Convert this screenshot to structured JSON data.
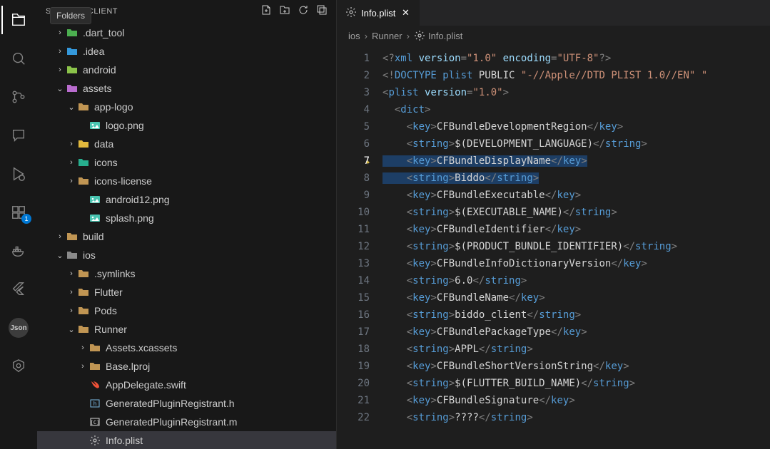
{
  "tooltip": "Folders",
  "sidebarHeader": {
    "title": "S: BIDDO_CLIENT"
  },
  "badge": "1",
  "jsonLabel": "Json",
  "tree": [
    {
      "indent": 1,
      "twist": "›",
      "icon": "folder-green",
      "label": ".dart_tool"
    },
    {
      "indent": 1,
      "twist": "›",
      "icon": "folder-blue",
      "label": ".idea"
    },
    {
      "indent": 1,
      "twist": "›",
      "icon": "folder-lime",
      "label": "android"
    },
    {
      "indent": 1,
      "twist": "⌄",
      "icon": "folder-pink",
      "label": "assets"
    },
    {
      "indent": 2,
      "twist": "⌄",
      "icon": "folder",
      "label": "app-logo"
    },
    {
      "indent": 3,
      "twist": "",
      "icon": "img",
      "label": "logo.png"
    },
    {
      "indent": 2,
      "twist": "›",
      "icon": "folder-yellow",
      "label": "data"
    },
    {
      "indent": 2,
      "twist": "›",
      "icon": "folder-teal",
      "label": "icons"
    },
    {
      "indent": 2,
      "twist": "›",
      "icon": "folder",
      "label": "icons-license"
    },
    {
      "indent": 3,
      "twist": "",
      "icon": "img",
      "label": "android12.png"
    },
    {
      "indent": 3,
      "twist": "",
      "icon": "img",
      "label": "splash.png"
    },
    {
      "indent": 1,
      "twist": "›",
      "icon": "folder",
      "label": "build"
    },
    {
      "indent": 1,
      "twist": "⌄",
      "icon": "folder-gray",
      "label": "ios"
    },
    {
      "indent": 2,
      "twist": "›",
      "icon": "folder",
      "label": ".symlinks"
    },
    {
      "indent": 2,
      "twist": "›",
      "icon": "folder",
      "label": "Flutter"
    },
    {
      "indent": 2,
      "twist": "›",
      "icon": "folder",
      "label": "Pods"
    },
    {
      "indent": 2,
      "twist": "⌄",
      "icon": "folder",
      "label": "Runner"
    },
    {
      "indent": 3,
      "twist": "›",
      "icon": "folder",
      "label": "Assets.xcassets"
    },
    {
      "indent": 3,
      "twist": "›",
      "icon": "folder",
      "label": "Base.lproj"
    },
    {
      "indent": 3,
      "twist": "",
      "icon": "swift",
      "label": "AppDelegate.swift"
    },
    {
      "indent": 3,
      "twist": "",
      "icon": "h",
      "label": "GeneratedPluginRegistrant.h"
    },
    {
      "indent": 3,
      "twist": "",
      "icon": "c",
      "label": "GeneratedPluginRegistrant.m"
    },
    {
      "indent": 3,
      "twist": "",
      "icon": "gear",
      "label": "Info.plist",
      "selected": true
    }
  ],
  "tab": {
    "label": "Info.plist"
  },
  "breadcrumbs": [
    "ios",
    "Runner",
    "Info.plist"
  ],
  "code": [
    {
      "n": 1,
      "tokens": [
        {
          "c": "t-punc",
          "t": "<?"
        },
        {
          "c": "t-tag",
          "t": "xml "
        },
        {
          "c": "t-attr",
          "t": "version"
        },
        {
          "c": "t-punc",
          "t": "="
        },
        {
          "c": "t-str",
          "t": "\"1.0\""
        },
        {
          "c": "t-attr",
          "t": " encoding"
        },
        {
          "c": "t-punc",
          "t": "="
        },
        {
          "c": "t-str",
          "t": "\"UTF-8\""
        },
        {
          "c": "t-punc",
          "t": "?>"
        }
      ]
    },
    {
      "n": 2,
      "tokens": [
        {
          "c": "t-punc",
          "t": "<!"
        },
        {
          "c": "t-tag",
          "t": "DOCTYPE plist "
        },
        {
          "c": "t-text",
          "t": "PUBLIC "
        },
        {
          "c": "t-str",
          "t": "\"-//Apple//DTD PLIST 1.0//EN\" \""
        }
      ]
    },
    {
      "n": 3,
      "tokens": [
        {
          "c": "t-punc",
          "t": "<"
        },
        {
          "c": "t-tag",
          "t": "plist "
        },
        {
          "c": "t-attr",
          "t": "version"
        },
        {
          "c": "t-punc",
          "t": "="
        },
        {
          "c": "t-str",
          "t": "\"1.0\""
        },
        {
          "c": "t-punc",
          "t": ">"
        }
      ]
    },
    {
      "n": 4,
      "indent": 1,
      "tokens": [
        {
          "c": "t-punc",
          "t": "<"
        },
        {
          "c": "t-tag",
          "t": "dict"
        },
        {
          "c": "t-punc",
          "t": ">"
        }
      ]
    },
    {
      "n": 5,
      "indent": 2,
      "tokens": [
        {
          "c": "t-punc",
          "t": "<"
        },
        {
          "c": "t-tag",
          "t": "key"
        },
        {
          "c": "t-punc",
          "t": ">"
        },
        {
          "c": "t-text",
          "t": "CFBundleDevelopmentRegion"
        },
        {
          "c": "t-punc",
          "t": "</"
        },
        {
          "c": "t-tag",
          "t": "key"
        },
        {
          "c": "t-punc",
          "t": ">"
        }
      ]
    },
    {
      "n": 6,
      "indent": 2,
      "tokens": [
        {
          "c": "t-punc",
          "t": "<"
        },
        {
          "c": "t-tag",
          "t": "string"
        },
        {
          "c": "t-punc",
          "t": ">"
        },
        {
          "c": "t-text",
          "t": "$(DEVELOPMENT_LANGUAGE)"
        },
        {
          "c": "t-punc",
          "t": "</"
        },
        {
          "c": "t-tag",
          "t": "string"
        },
        {
          "c": "t-punc",
          "t": ">"
        }
      ]
    },
    {
      "n": 7,
      "indent": 2,
      "current": true,
      "sparkle": true,
      "hl": true,
      "tokens": [
        {
          "c": "t-punc",
          "t": "<"
        },
        {
          "c": "t-tag",
          "t": "key"
        },
        {
          "c": "t-punc",
          "t": ">"
        },
        {
          "c": "t-text",
          "t": "CFBundleDisplayName"
        },
        {
          "c": "t-punc",
          "t": "</"
        },
        {
          "c": "t-tag",
          "t": "key"
        },
        {
          "c": "t-punc",
          "t": ">"
        }
      ]
    },
    {
      "n": 8,
      "indent": 2,
      "hl": true,
      "tokens": [
        {
          "c": "t-punc",
          "t": "<"
        },
        {
          "c": "t-tag",
          "t": "string"
        },
        {
          "c": "t-punc",
          "t": ">"
        },
        {
          "c": "t-text",
          "t": "Biddo"
        },
        {
          "c": "t-punc",
          "t": "</"
        },
        {
          "c": "t-tag",
          "t": "string"
        },
        {
          "c": "t-punc",
          "t": ">"
        }
      ]
    },
    {
      "n": 9,
      "indent": 2,
      "tokens": [
        {
          "c": "t-punc",
          "t": "<"
        },
        {
          "c": "t-tag",
          "t": "key"
        },
        {
          "c": "t-punc",
          "t": ">"
        },
        {
          "c": "t-text",
          "t": "CFBundleExecutable"
        },
        {
          "c": "t-punc",
          "t": "</"
        },
        {
          "c": "t-tag",
          "t": "key"
        },
        {
          "c": "t-punc",
          "t": ">"
        }
      ]
    },
    {
      "n": 10,
      "indent": 2,
      "tokens": [
        {
          "c": "t-punc",
          "t": "<"
        },
        {
          "c": "t-tag",
          "t": "string"
        },
        {
          "c": "t-punc",
          "t": ">"
        },
        {
          "c": "t-text",
          "t": "$(EXECUTABLE_NAME)"
        },
        {
          "c": "t-punc",
          "t": "</"
        },
        {
          "c": "t-tag",
          "t": "string"
        },
        {
          "c": "t-punc",
          "t": ">"
        }
      ]
    },
    {
      "n": 11,
      "indent": 2,
      "tokens": [
        {
          "c": "t-punc",
          "t": "<"
        },
        {
          "c": "t-tag",
          "t": "key"
        },
        {
          "c": "t-punc",
          "t": ">"
        },
        {
          "c": "t-text",
          "t": "CFBundleIdentifier"
        },
        {
          "c": "t-punc",
          "t": "</"
        },
        {
          "c": "t-tag",
          "t": "key"
        },
        {
          "c": "t-punc",
          "t": ">"
        }
      ]
    },
    {
      "n": 12,
      "indent": 2,
      "tokens": [
        {
          "c": "t-punc",
          "t": "<"
        },
        {
          "c": "t-tag",
          "t": "string"
        },
        {
          "c": "t-punc",
          "t": ">"
        },
        {
          "c": "t-text",
          "t": "$(PRODUCT_BUNDLE_IDENTIFIER)"
        },
        {
          "c": "t-punc",
          "t": "</"
        },
        {
          "c": "t-tag",
          "t": "string"
        },
        {
          "c": "t-punc",
          "t": ">"
        }
      ]
    },
    {
      "n": 13,
      "indent": 2,
      "tokens": [
        {
          "c": "t-punc",
          "t": "<"
        },
        {
          "c": "t-tag",
          "t": "key"
        },
        {
          "c": "t-punc",
          "t": ">"
        },
        {
          "c": "t-text",
          "t": "CFBundleInfoDictionaryVersion"
        },
        {
          "c": "t-punc",
          "t": "</"
        },
        {
          "c": "t-tag",
          "t": "key"
        },
        {
          "c": "t-punc",
          "t": ">"
        }
      ]
    },
    {
      "n": 14,
      "indent": 2,
      "tokens": [
        {
          "c": "t-punc",
          "t": "<"
        },
        {
          "c": "t-tag",
          "t": "string"
        },
        {
          "c": "t-punc",
          "t": ">"
        },
        {
          "c": "t-text",
          "t": "6.0"
        },
        {
          "c": "t-punc",
          "t": "</"
        },
        {
          "c": "t-tag",
          "t": "string"
        },
        {
          "c": "t-punc",
          "t": ">"
        }
      ]
    },
    {
      "n": 15,
      "indent": 2,
      "tokens": [
        {
          "c": "t-punc",
          "t": "<"
        },
        {
          "c": "t-tag",
          "t": "key"
        },
        {
          "c": "t-punc",
          "t": ">"
        },
        {
          "c": "t-text",
          "t": "CFBundleName"
        },
        {
          "c": "t-punc",
          "t": "</"
        },
        {
          "c": "t-tag",
          "t": "key"
        },
        {
          "c": "t-punc",
          "t": ">"
        }
      ]
    },
    {
      "n": 16,
      "indent": 2,
      "tokens": [
        {
          "c": "t-punc",
          "t": "<"
        },
        {
          "c": "t-tag",
          "t": "string"
        },
        {
          "c": "t-punc",
          "t": ">"
        },
        {
          "c": "t-text",
          "t": "biddo_client"
        },
        {
          "c": "t-punc",
          "t": "</"
        },
        {
          "c": "t-tag",
          "t": "string"
        },
        {
          "c": "t-punc",
          "t": ">"
        }
      ]
    },
    {
      "n": 17,
      "indent": 2,
      "tokens": [
        {
          "c": "t-punc",
          "t": "<"
        },
        {
          "c": "t-tag",
          "t": "key"
        },
        {
          "c": "t-punc",
          "t": ">"
        },
        {
          "c": "t-text",
          "t": "CFBundlePackageType"
        },
        {
          "c": "t-punc",
          "t": "</"
        },
        {
          "c": "t-tag",
          "t": "key"
        },
        {
          "c": "t-punc",
          "t": ">"
        }
      ]
    },
    {
      "n": 18,
      "indent": 2,
      "tokens": [
        {
          "c": "t-punc",
          "t": "<"
        },
        {
          "c": "t-tag",
          "t": "string"
        },
        {
          "c": "t-punc",
          "t": ">"
        },
        {
          "c": "t-text",
          "t": "APPL"
        },
        {
          "c": "t-punc",
          "t": "</"
        },
        {
          "c": "t-tag",
          "t": "string"
        },
        {
          "c": "t-punc",
          "t": ">"
        }
      ]
    },
    {
      "n": 19,
      "indent": 2,
      "tokens": [
        {
          "c": "t-punc",
          "t": "<"
        },
        {
          "c": "t-tag",
          "t": "key"
        },
        {
          "c": "t-punc",
          "t": ">"
        },
        {
          "c": "t-text",
          "t": "CFBundleShortVersionString"
        },
        {
          "c": "t-punc",
          "t": "</"
        },
        {
          "c": "t-tag",
          "t": "key"
        },
        {
          "c": "t-punc",
          "t": ">"
        }
      ]
    },
    {
      "n": 20,
      "indent": 2,
      "tokens": [
        {
          "c": "t-punc",
          "t": "<"
        },
        {
          "c": "t-tag",
          "t": "string"
        },
        {
          "c": "t-punc",
          "t": ">"
        },
        {
          "c": "t-text",
          "t": "$(FLUTTER_BUILD_NAME)"
        },
        {
          "c": "t-punc",
          "t": "</"
        },
        {
          "c": "t-tag",
          "t": "string"
        },
        {
          "c": "t-punc",
          "t": ">"
        }
      ]
    },
    {
      "n": 21,
      "indent": 2,
      "tokens": [
        {
          "c": "t-punc",
          "t": "<"
        },
        {
          "c": "t-tag",
          "t": "key"
        },
        {
          "c": "t-punc",
          "t": ">"
        },
        {
          "c": "t-text",
          "t": "CFBundleSignature"
        },
        {
          "c": "t-punc",
          "t": "</"
        },
        {
          "c": "t-tag",
          "t": "key"
        },
        {
          "c": "t-punc",
          "t": ">"
        }
      ]
    },
    {
      "n": 22,
      "indent": 2,
      "tokens": [
        {
          "c": "t-punc",
          "t": "<"
        },
        {
          "c": "t-tag",
          "t": "string"
        },
        {
          "c": "t-punc",
          "t": ">"
        },
        {
          "c": "t-text",
          "t": "????"
        },
        {
          "c": "t-punc",
          "t": "</"
        },
        {
          "c": "t-tag",
          "t": "string"
        },
        {
          "c": "t-punc",
          "t": ">"
        }
      ]
    }
  ]
}
